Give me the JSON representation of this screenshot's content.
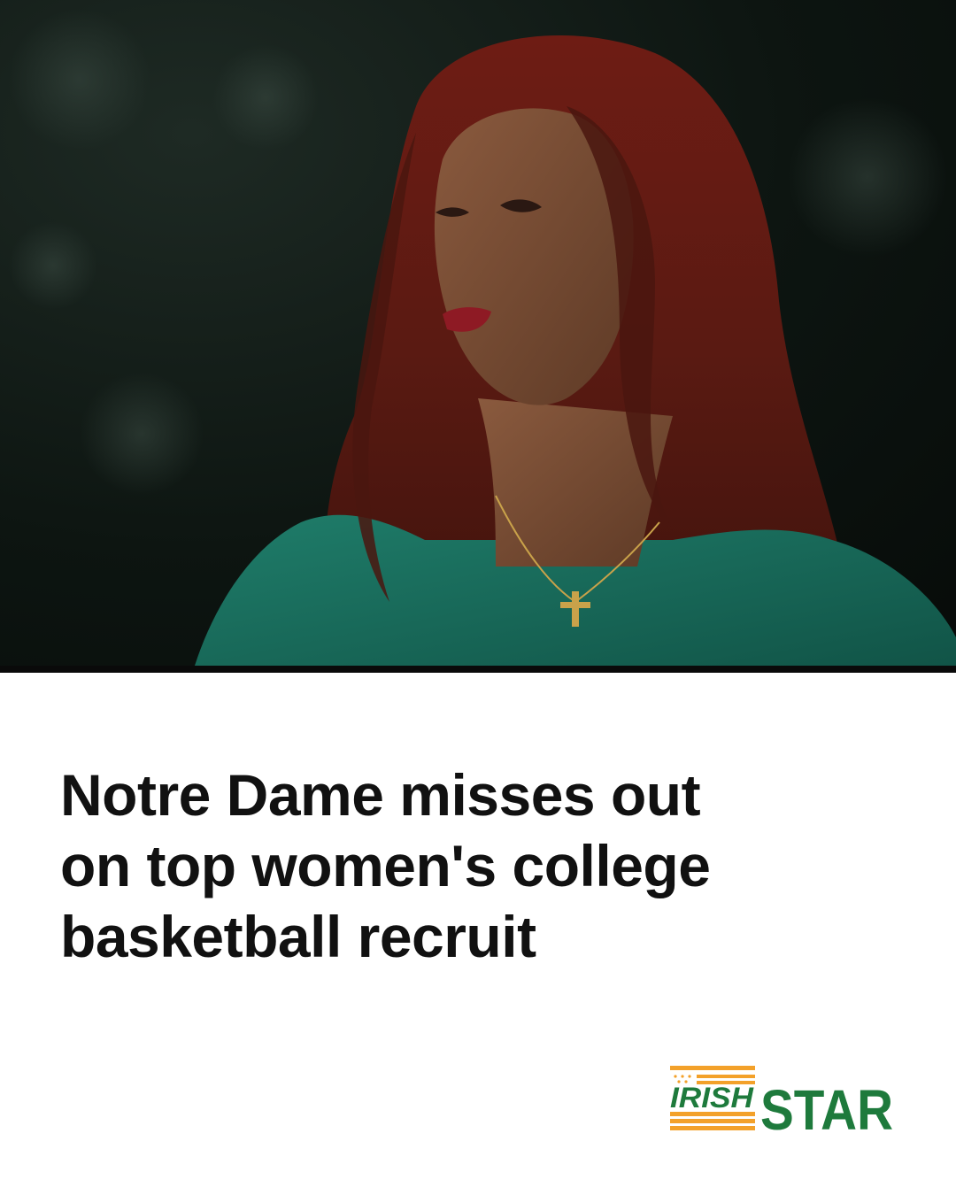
{
  "photo": {
    "subject": "coach-portrait"
  },
  "headline": {
    "line1": "Notre Dame misses out",
    "line2": "on top women's college",
    "line3": "basketball recruit"
  },
  "brand": {
    "logo_word_irish": "IRISH",
    "logo_word_star": "STAR",
    "colors": {
      "green": "#1e7a3c",
      "orange": "#f3a12a",
      "dark": "#0a0a0a"
    }
  }
}
